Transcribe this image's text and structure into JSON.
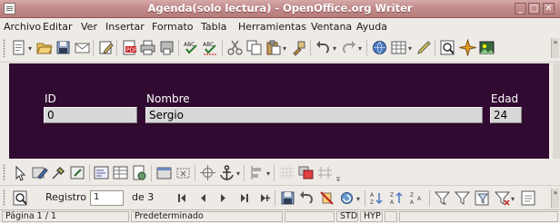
{
  "window": {
    "title": "Agenda(solo lectura) - OpenOffice.org Writer",
    "min_glyph": "_",
    "max_glyph": "□",
    "close_glyph": "✕"
  },
  "menu": {
    "items": [
      "Archivo",
      "Editar",
      "Ver",
      "Insertar",
      "Formato",
      "Tabla",
      "Herramientas",
      "Ventana",
      "Ayuda"
    ]
  },
  "form": {
    "background": "#300a30",
    "id_label": "ID",
    "id_value": "0",
    "name_label": "Nombre",
    "name_value": "Sergio",
    "age_label": "Edad",
    "age_value": "24"
  },
  "navigation": {
    "record_label": "Registro",
    "record_value": "1",
    "of_label": "de 3"
  },
  "status": {
    "page": "Página 1 / 1",
    "style": "Predeterminado",
    "std": "STD",
    "hyp": "HYP"
  },
  "icons": {
    "standard_toolbar": [
      "new-document-icon",
      "open-folder-icon",
      "save-icon",
      "email-icon",
      "edit-file-icon",
      "export-pdf-icon",
      "print-icon",
      "print-preview-icon",
      "spellcheck-icon",
      "autospellcheck-icon",
      "cut-icon",
      "copy-icon",
      "paste-icon",
      "format-paintbrush-icon",
      "undo-icon",
      "redo-icon",
      "hyperlink-icon",
      "table-icon",
      "show-draw-functions-icon",
      "find-replace-icon",
      "navigator-icon",
      "gallery-icon"
    ],
    "form_controls_toolbar": [
      "select-icon",
      "form-design-mode-icon",
      "control-properties-icon",
      "form-properties-icon",
      "tab-order-icon",
      "add-field-icon",
      "form-navigator-icon",
      "open-design-mode-icon",
      "autocontrol-focus-icon",
      "position-size-icon",
      "anchor-icon",
      "align-icon",
      "bring-front-icon",
      "grid-icon",
      "group-icon",
      "ungroup-icon"
    ],
    "navigation_toolbar": [
      "find-record-icon",
      "first-record-icon",
      "previous-record-icon",
      "next-record-icon",
      "last-record-icon",
      "save-record-icon",
      "undo-record-icon",
      "delete-record-icon",
      "refresh-icon",
      "sort-ascending-icon",
      "sort-descending-icon",
      "sort-icon",
      "autofilter-icon",
      "apply-filter-icon",
      "form-filter-icon",
      "data-to-text-icon"
    ]
  }
}
